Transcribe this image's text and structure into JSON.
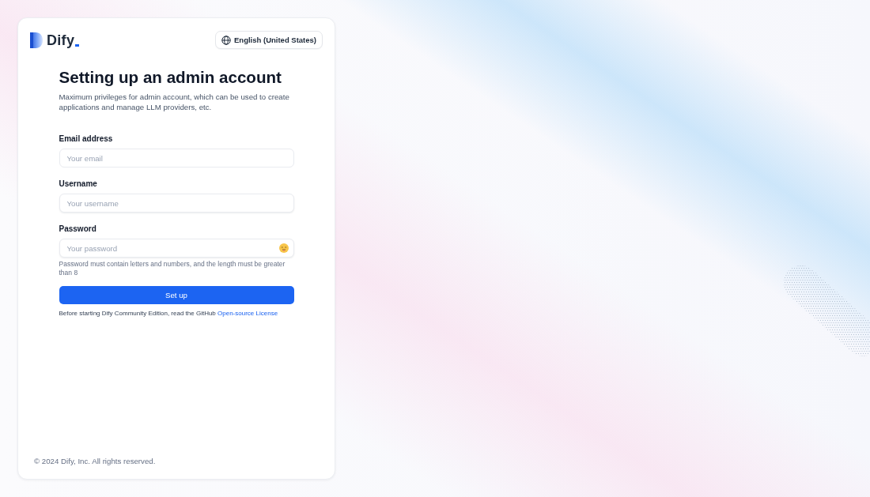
{
  "brand": {
    "name": "Dify"
  },
  "language_selector": {
    "value": "English (United States)"
  },
  "heading": "Setting up an admin account",
  "description": "Maximum privileges for admin account, which can be used to create applications and manage LLM providers, etc.",
  "fields": [
    {
      "kind": "email",
      "label": "Email address",
      "placeholder": "Your email"
    },
    {
      "kind": "text",
      "label": "Username",
      "placeholder": "Your username"
    },
    {
      "kind": "password",
      "label": "Password",
      "placeholder": "Your password",
      "hint": "Password must contain letters and numbers, and the length must be greater than 8"
    }
  ],
  "submit_button": "Set up",
  "license_notice": {
    "text": "Before starting Dify Community Edition, read the GitHub",
    "link": "Open-source License"
  },
  "footer": "© 2024 Dify, Inc. All rights reserved."
}
